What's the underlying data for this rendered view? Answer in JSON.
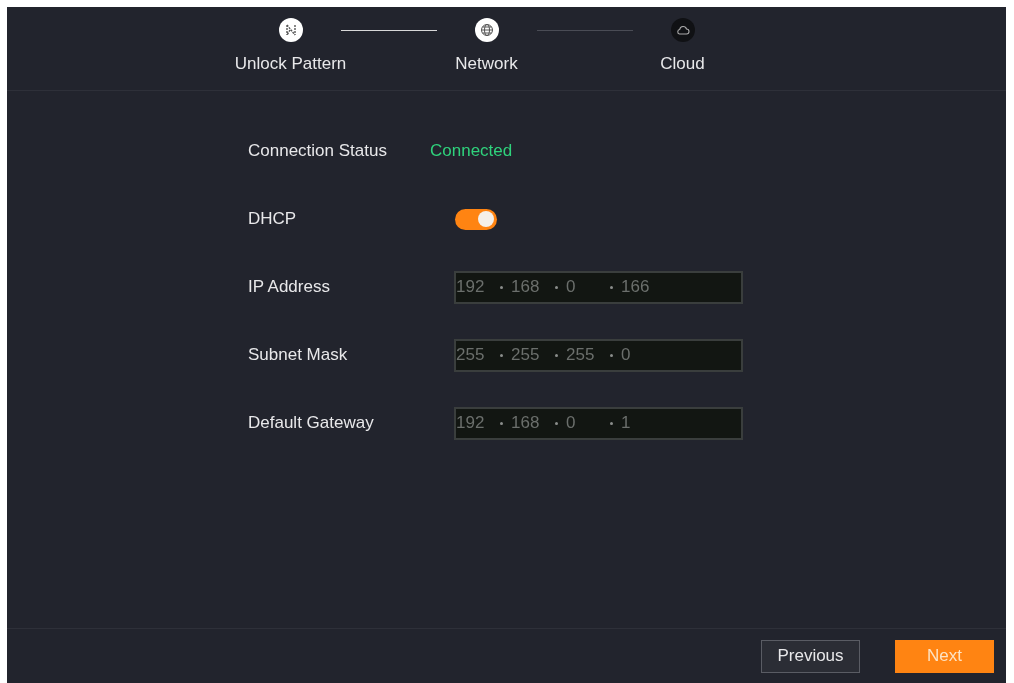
{
  "steps": [
    {
      "label": "Unlock Pattern",
      "kind": "pattern",
      "done": true
    },
    {
      "label": "Network",
      "kind": "globe",
      "done": true
    },
    {
      "label": "Cloud",
      "kind": "cloud",
      "done": false
    }
  ],
  "status": {
    "label": "Connection Status",
    "value": "Connected"
  },
  "dhcp": {
    "label": "DHCP",
    "on": true
  },
  "fields": [
    {
      "label": "IP Address",
      "segments": [
        "192",
        "168",
        "0",
        "166"
      ]
    },
    {
      "label": "Subnet Mask",
      "segments": [
        "255",
        "255",
        "255",
        "0"
      ]
    },
    {
      "label": "Default Gateway",
      "segments": [
        "192",
        "168",
        "0",
        "1"
      ]
    }
  ],
  "buttons": [
    {
      "label": "Previous",
      "kind": "secondary"
    },
    {
      "label": "Next",
      "kind": "primary"
    }
  ]
}
